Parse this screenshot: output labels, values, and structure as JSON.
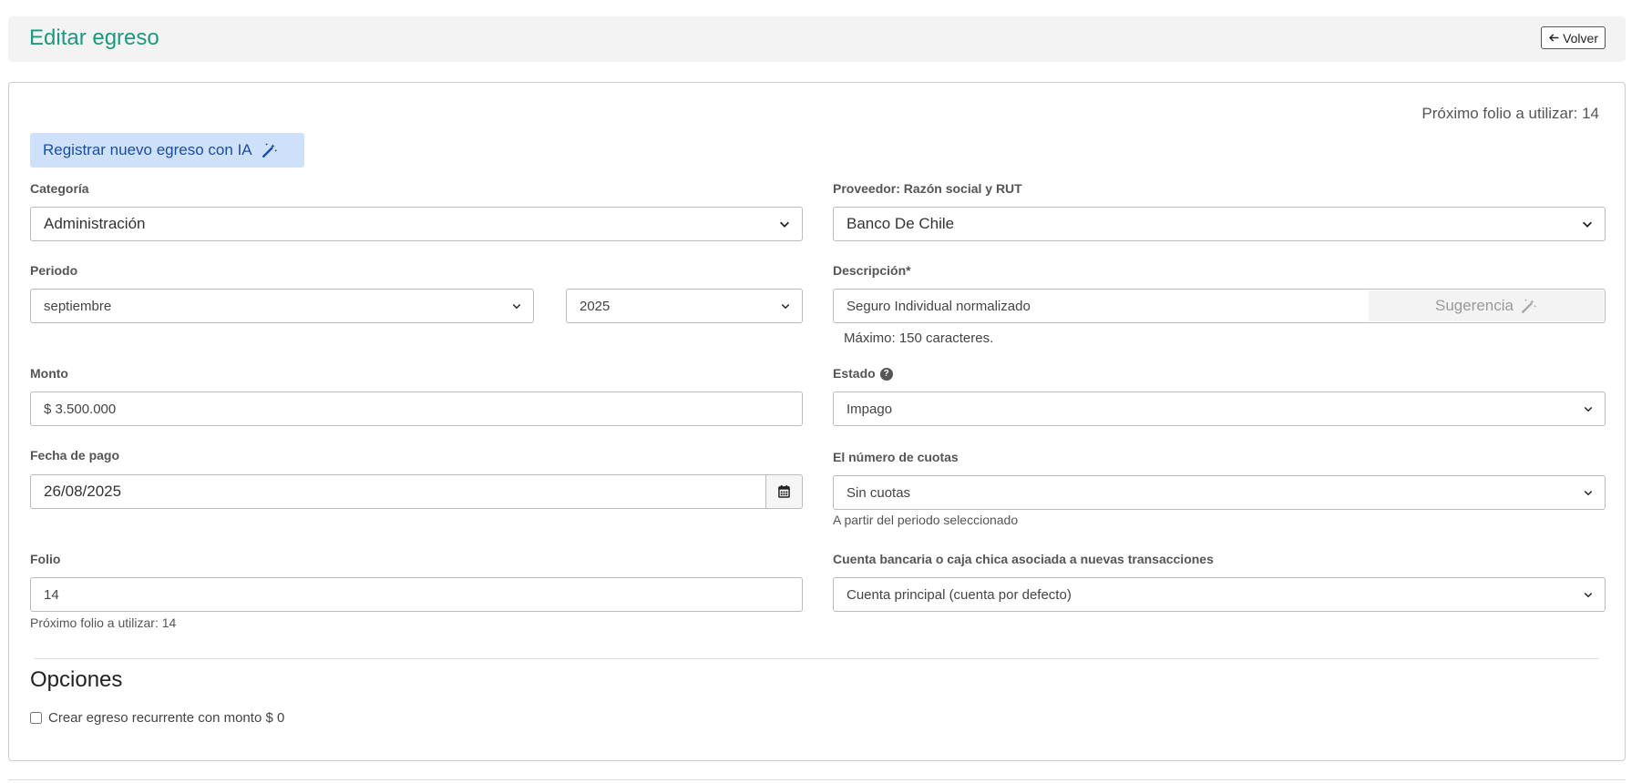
{
  "header": {
    "title": "Editar egreso",
    "back_label": "Volver"
  },
  "form": {
    "next_folio_top": "Próximo folio a utilizar: 14",
    "ai_button_label": "Registrar nuevo egreso con IA",
    "categoria": {
      "label": "Categoría",
      "value": "Administración"
    },
    "proveedor": {
      "label": "Proveedor: Razón social y RUT",
      "value": "Banco De Chile"
    },
    "periodo": {
      "label": "Periodo",
      "month": "septiembre",
      "year": "2025"
    },
    "descripcion": {
      "label": "Descripción*",
      "value": "Seguro Individual normalizado",
      "suggest_label": "Sugerencia",
      "help": "Máximo: 150 caracteres."
    },
    "monto": {
      "label": "Monto",
      "value": "$ 3.500.000"
    },
    "estado": {
      "label": "Estado",
      "value": "Impago"
    },
    "fecha_pago": {
      "label": "Fecha de pago",
      "value": "26/08/2025"
    },
    "cuotas": {
      "label": "El número de cuotas",
      "value": "Sin cuotas",
      "help": "A partir del periodo seleccionado"
    },
    "folio": {
      "label": "Folio",
      "value": "14",
      "help": "Próximo folio a utilizar: 14"
    },
    "cuenta": {
      "label": "Cuenta bancaria o caja chica asociada a nuevas transacciones",
      "value": "Cuenta principal (cuenta por defecto)"
    }
  },
  "options": {
    "title": "Opciones",
    "recurring_label": "Crear egreso recurrente con monto $ 0"
  },
  "colors": {
    "title": "#1a9a7e",
    "ai_button_bg": "#cfe0fb",
    "ai_button_text": "#1a4fa0"
  },
  "icons": {
    "back": "arrow-left-icon",
    "ai": "magic-wand-icon",
    "dropdown": "chevron-down-icon",
    "calendar": "calendar-icon",
    "help": "question-circle-icon"
  }
}
